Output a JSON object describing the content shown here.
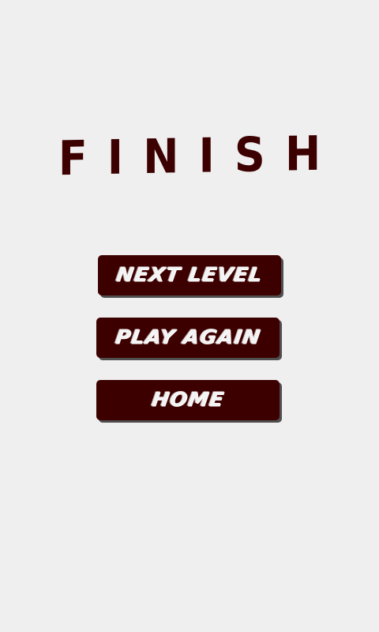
{
  "screen": {
    "title": "FINISH"
  },
  "menu": {
    "next_level_label": "NEXT LEVEL",
    "play_again_label": "PLAY AGAIN",
    "home_label": "HOME"
  },
  "colors": {
    "background": "#efefef",
    "accent": "#3d0000",
    "button_text": "#f3f3f3",
    "button_shadow": "#4f4f4f"
  }
}
